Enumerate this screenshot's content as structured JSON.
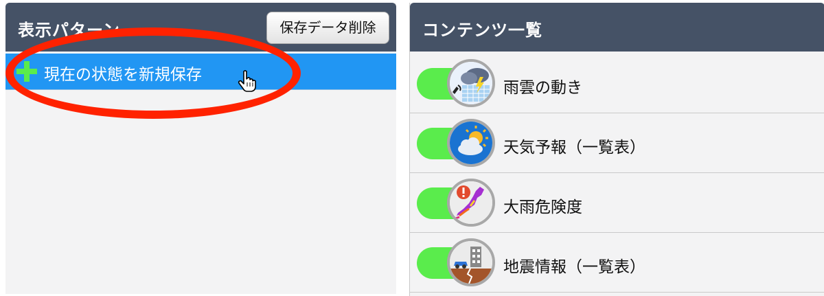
{
  "left_panel": {
    "title": "表示パターン",
    "delete_button": "保存データ削除",
    "save_new_label": "現在の状態を新規保存"
  },
  "right_panel": {
    "title": "コンテンツ一覧",
    "items": [
      {
        "label": "雨雲の動き",
        "icon": "rain-cloud-radar-icon",
        "enabled": true
      },
      {
        "label": "天気予報（一覧表）",
        "icon": "sun-cloud-icon",
        "enabled": true
      },
      {
        "label": "大雨危険度",
        "icon": "japan-map-warning-icon",
        "enabled": true
      },
      {
        "label": "地震情報（一覧表）",
        "icon": "earthquake-building-icon",
        "enabled": true
      }
    ]
  },
  "colors": {
    "header": "#455266",
    "selected_row": "#2196f3",
    "toggle_on": "#5aec4c",
    "annotation": "#ff2200"
  }
}
